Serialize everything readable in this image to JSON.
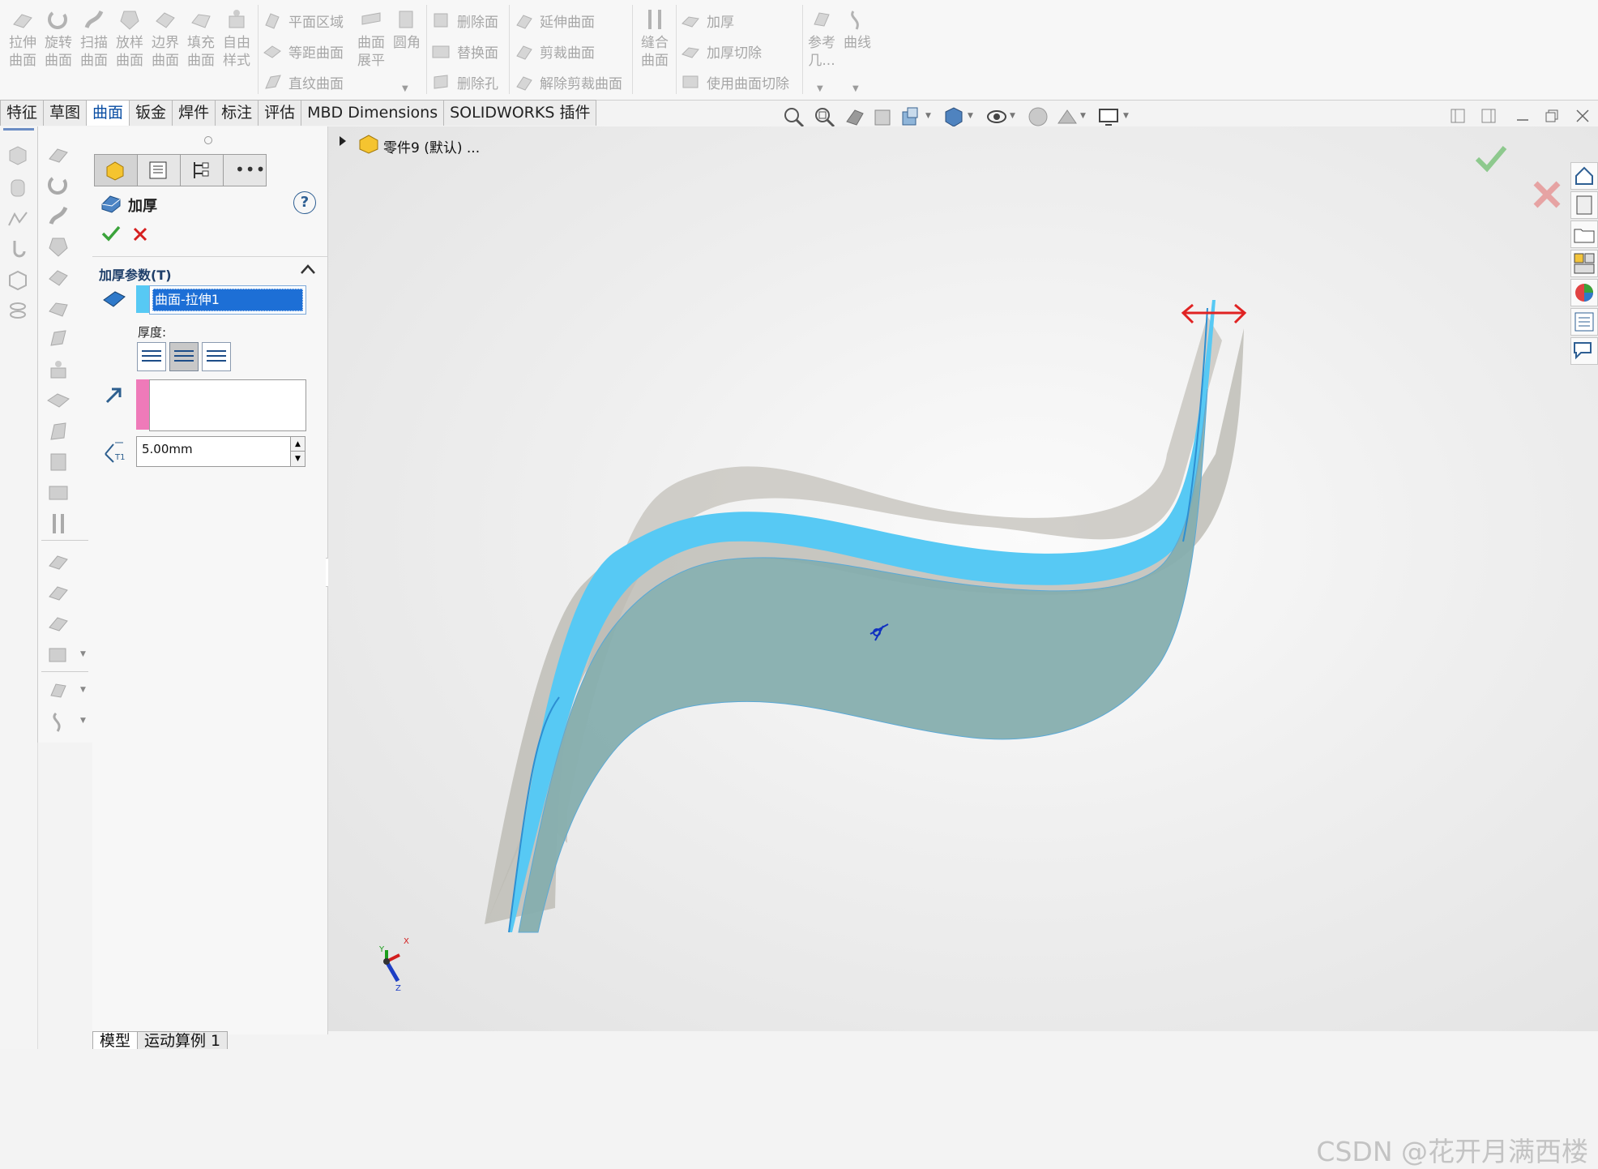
{
  "ribbon": {
    "big_buttons": [
      {
        "line1": "拉伸",
        "line2": "曲面",
        "icon": "extrude-surface-icon"
      },
      {
        "line1": "旋转",
        "line2": "曲面",
        "icon": "revolve-surface-icon"
      },
      {
        "line1": "扫描",
        "line2": "曲面",
        "icon": "sweep-surface-icon"
      },
      {
        "line1": "放样",
        "line2": "曲面",
        "icon": "loft-surface-icon"
      },
      {
        "line1": "边界",
        "line2": "曲面",
        "icon": "boundary-surface-icon"
      },
      {
        "line1": "填充",
        "line2": "曲面",
        "icon": "fill-surface-icon"
      },
      {
        "line1": "自由",
        "line2": "样式",
        "icon": "freeform-icon"
      }
    ],
    "col2": [
      "平面区域",
      "等距曲面",
      "直纹曲面"
    ],
    "flatten": {
      "line1": "曲面",
      "line2": "展平"
    },
    "fillet": "圆角",
    "col3": [
      "删除面",
      "替换面",
      "删除孔"
    ],
    "col4": [
      "延伸曲面",
      "剪裁曲面",
      "解除剪裁曲面"
    ],
    "knit": {
      "line1": "缝合",
      "line2": "曲面"
    },
    "col5": [
      "加厚",
      "加厚切除",
      "使用曲面切除"
    ],
    "ref": {
      "line1": "参考",
      "line2": "几..."
    },
    "curves": "曲线"
  },
  "tabs": [
    "特征",
    "草图",
    "曲面",
    "钣金",
    "焊件",
    "标注",
    "评估",
    "MBD Dimensions",
    "SOLIDWORKS 插件"
  ],
  "active_tab": "曲面",
  "tree": {
    "item": "零件9 (默认) ..."
  },
  "property_manager": {
    "title": "加厚",
    "help": "?",
    "section_title": "加厚参数(T)",
    "selected_surface": "曲面-拉伸1",
    "thickness_label": "厚度:",
    "t1_label": "T1",
    "thickness_value": "5.00mm"
  },
  "axes": {
    "x": "X",
    "y": "Y",
    "z": "Z"
  },
  "bottom_tabs": [
    "模型",
    "运动算例 1"
  ],
  "watermark": "CSDN @花开月满西楼",
  "colors": {
    "accent_blue": "#57c9f4",
    "surface_teal": "#86aeae",
    "accept_green": "#3aa33a",
    "cancel_red": "#d61f1f",
    "selection_blue": "#1d6fd6"
  }
}
